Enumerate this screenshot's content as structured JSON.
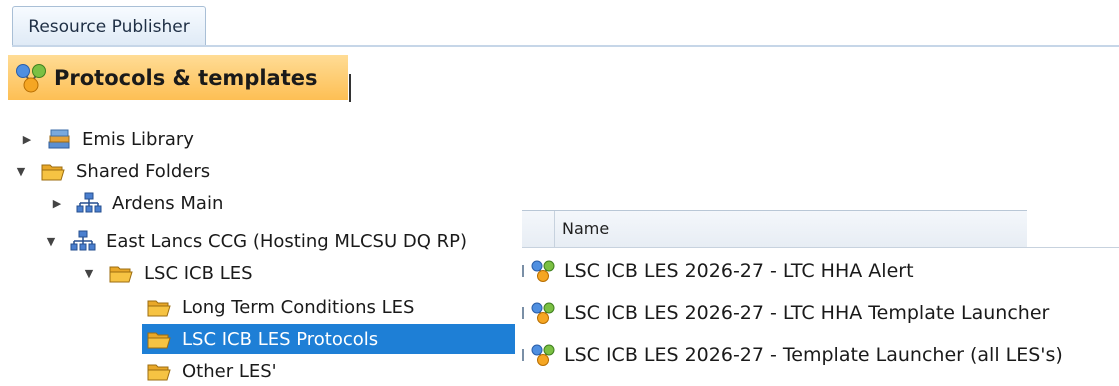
{
  "tab": {
    "label": "Resource Publisher"
  },
  "header": {
    "title": "Protocols & templates",
    "icon": "protocol-icon"
  },
  "tree": [
    {
      "label": "Emis Library",
      "expander": "collapsed",
      "icon": "books-icon"
    },
    {
      "label": "Shared Folders",
      "expander": "expanded",
      "icon": "folder-open-icon"
    },
    {
      "label": "Ardens Main",
      "expander": "collapsed",
      "icon": "network-icon"
    },
    {
      "label": "East Lancs CCG (Hosting MLCSU DQ RP)",
      "expander": "expanded",
      "icon": "network-icon"
    },
    {
      "label": "LSC ICB LES",
      "expander": "expanded",
      "icon": "folder-open-icon"
    },
    {
      "label": "Long Term Conditions LES",
      "expander": "none",
      "icon": "folder-open-icon"
    },
    {
      "label": "LSC ICB LES Protocols",
      "expander": "none",
      "icon": "folder-open-icon",
      "selected": true
    },
    {
      "label": "Other LES'",
      "expander": "none",
      "icon": "folder-open-icon"
    }
  ],
  "list": {
    "column_header": "Name",
    "rows": [
      {
        "name": "LSC ICB LES 2026-27 - LTC HHA Alert",
        "icon": "protocol-icon"
      },
      {
        "name": "LSC ICB LES 2026-27 - LTC HHA Template Launcher",
        "icon": "protocol-icon"
      },
      {
        "name": "LSC ICB LES 2026-27 - Template Launcher (all LES's)",
        "icon": "protocol-icon"
      }
    ]
  },
  "colors": {
    "selection": "#1e7fd6",
    "header_orange": "#fdbf54",
    "folder": "#f6c343"
  }
}
